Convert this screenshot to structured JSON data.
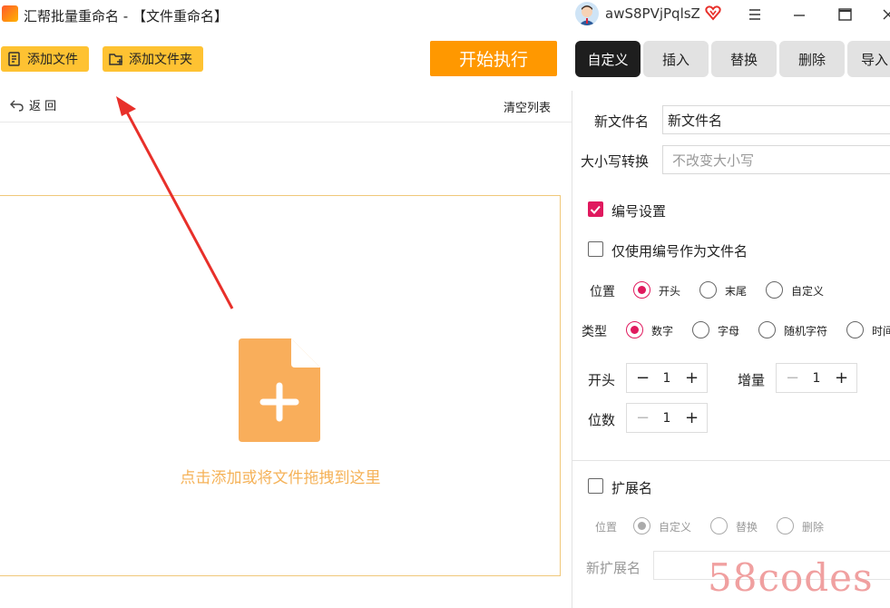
{
  "window": {
    "title": "汇帮批量重命名 - 【文件重命名】",
    "username": "awS8PVjPqlsZ"
  },
  "toolbar": {
    "add_file": "添加文件",
    "add_folder": "添加文件夹",
    "start": "开始执行"
  },
  "file_panel": {
    "back": "返 回",
    "clear_list": "清空列表",
    "drop_hint": "点击添加或将文件拖拽到这里"
  },
  "tabs": [
    {
      "label": "自定义",
      "active": true
    },
    {
      "label": "插入",
      "active": false
    },
    {
      "label": "替换",
      "active": false
    },
    {
      "label": "删除",
      "active": false
    },
    {
      "label": "导入",
      "active": false
    }
  ],
  "settings": {
    "new_name_label": "新文件名",
    "new_name_value": "新文件名",
    "case_label": "大小写转换",
    "case_placeholder": "不改变大小写",
    "numbering_label": "编号设置",
    "numbering_checked": true,
    "only_number_label": "仅使用编号作为文件名",
    "only_number_checked": false,
    "position_label": "位置",
    "position_options": [
      "开头",
      "末尾",
      "自定义"
    ],
    "position_selected": "开头",
    "type_label": "类型",
    "type_options": [
      "数字",
      "字母",
      "随机字符",
      "时间"
    ],
    "type_selected": "数字",
    "start_label": "开头",
    "start_value": "1",
    "increment_label": "增量",
    "increment_value": "1",
    "digits_label": "位数",
    "digits_value": "1"
  },
  "extension": {
    "label": "扩展名",
    "checked": false,
    "position_label": "位置",
    "options": [
      "自定义",
      "替换",
      "删除"
    ],
    "selected": "自定义",
    "new_ext_label": "新扩展名"
  },
  "watermark": "58codes",
  "colors": {
    "accent": "#e0195e",
    "toolbar_button": "#fec232",
    "start_button": "#ff9800",
    "drop_icon": "#f9ae5b",
    "arrow": "#e8302a"
  }
}
